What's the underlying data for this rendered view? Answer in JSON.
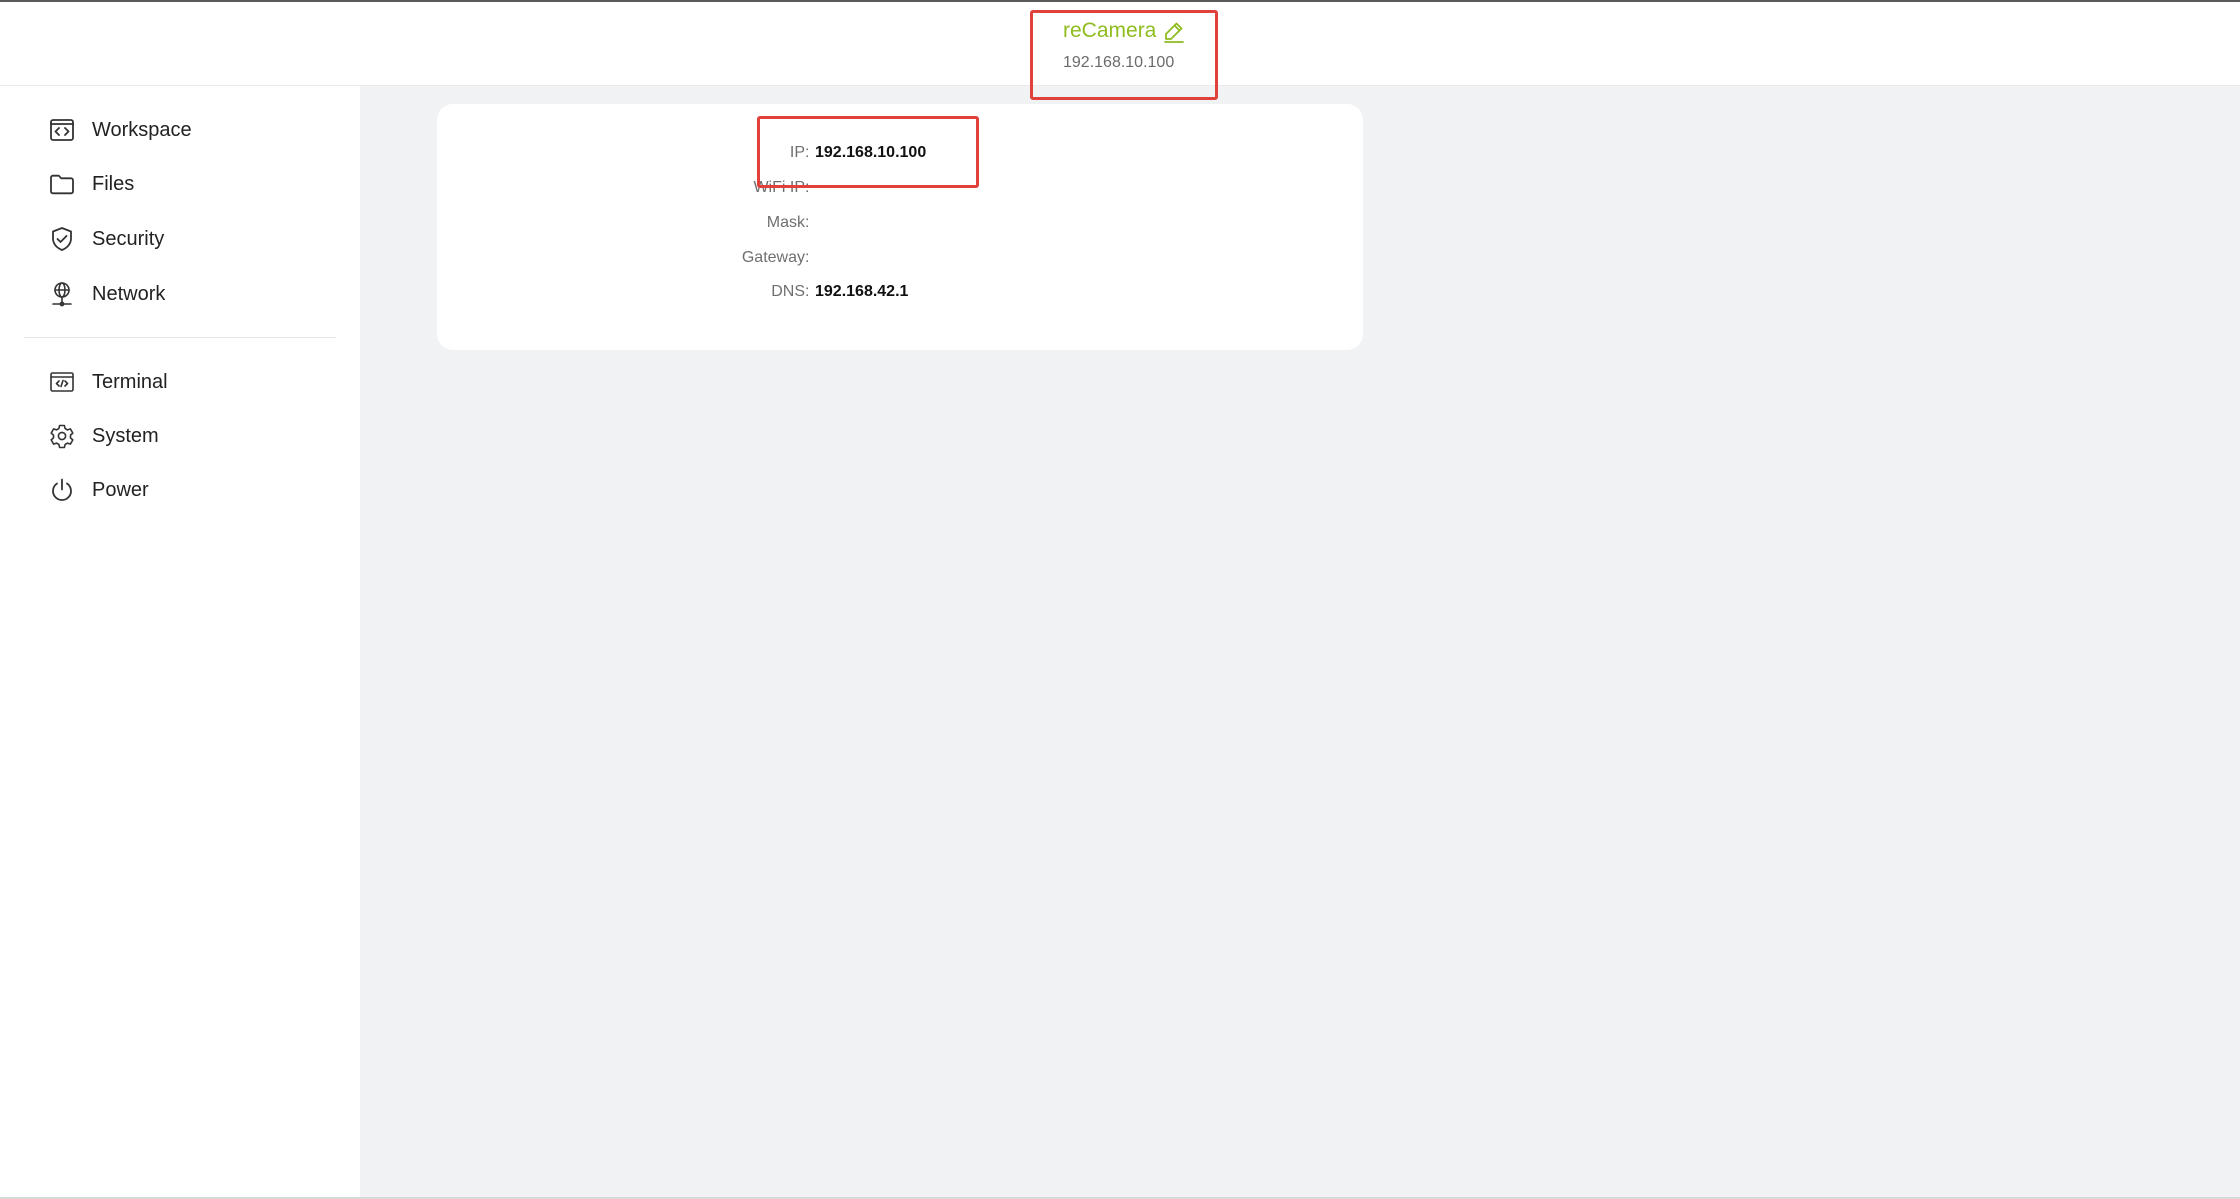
{
  "header": {
    "device_name": "reCamera",
    "device_ip": "192.168.10.100",
    "accent_color": "#8fbc1e"
  },
  "sidebar": {
    "items": [
      {
        "label": "Workspace",
        "icon": "code-window-icon"
      },
      {
        "label": "Files",
        "icon": "folder-icon"
      },
      {
        "label": "Security",
        "icon": "shield-check-icon"
      },
      {
        "label": "Network",
        "icon": "network-globe-icon"
      },
      {
        "label": "Terminal",
        "icon": "terminal-icon"
      },
      {
        "label": "System",
        "icon": "gear-icon"
      },
      {
        "label": "Power",
        "icon": "power-icon"
      }
    ]
  },
  "network_info": {
    "separator": ":",
    "rows": [
      {
        "label": "IP",
        "value": "192.168.10.100"
      },
      {
        "label": "WiFi IP",
        "value": ""
      },
      {
        "label": "Mask",
        "value": ""
      },
      {
        "label": "Gateway",
        "value": ""
      },
      {
        "label": "DNS",
        "value": "192.168.42.1"
      }
    ]
  },
  "highlight_color": "#e0413b"
}
